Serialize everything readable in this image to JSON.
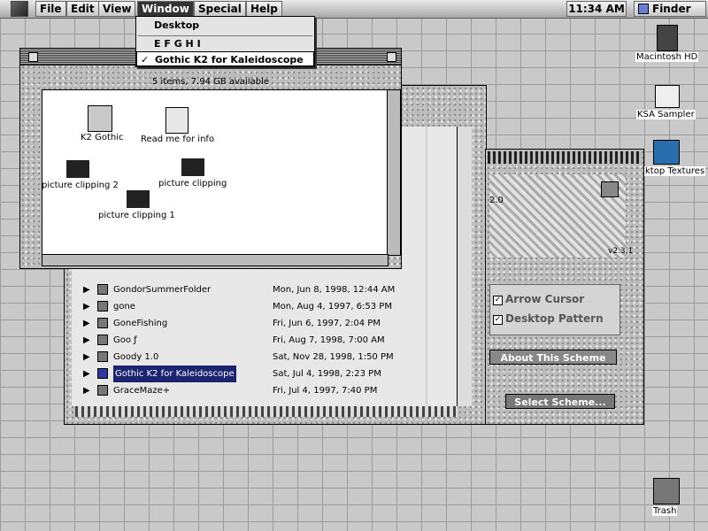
{
  "menubar": {
    "items": [
      "File",
      "Edit",
      "View",
      "Window",
      "Special",
      "Help"
    ],
    "clock": "11:34 AM",
    "app": "Finder"
  },
  "window_menu": {
    "items": [
      "Desktop",
      "E F G H I",
      "Gothic K2 for Kaleidoscope"
    ],
    "checked_item": "Gothic K2 for Kaleidoscope",
    "check_mark": "✓"
  },
  "front_window": {
    "status": "5 items, 7.94 GB available",
    "icons": [
      "K2 Gothic",
      "Read me for info",
      "picture clipping 2",
      "picture clipping",
      "picture clipping 1"
    ]
  },
  "list_window": {
    "rows": [
      {
        "name": "GondorSummerFolder",
        "date": "Mon, Jun 8, 1998, 12:44 AM",
        "selected": false
      },
      {
        "name": "gone",
        "date": "Mon, Aug 4, 1997, 6:53 PM",
        "selected": false
      },
      {
        "name": "GoneFishing",
        "date": "Fri, Jun 6, 1997, 2:04 PM",
        "selected": false
      },
      {
        "name": "Goo ƒ",
        "date": "Fri, Aug 7, 1998, 7:00 AM",
        "selected": false
      },
      {
        "name": "Goody 1.0",
        "date": "Sat, Nov 28, 1998, 1:50 PM",
        "selected": false
      },
      {
        "name": "Gothic K2 for Kaleidoscope",
        "date": "Sat, Jul 4, 1998, 2:23 PM",
        "selected": true
      },
      {
        "name": "GraceMaze+",
        "date": "Fri, Jul 4, 1997, 7:40 PM",
        "selected": false
      }
    ],
    "triangle": "▶"
  },
  "scheme_panel": {
    "version_left": "2.0",
    "version_right": "v2.3.1",
    "arrow_cursor": "Arrow Cursor",
    "desktop_pattern": "Desktop Pattern",
    "about_button": "About This Scheme",
    "select_button": "Select Scheme..."
  },
  "desktop_icons": [
    "Macintosh HD",
    "KSA Sampler",
    "ktop Textures",
    "Trash"
  ],
  "colors": {
    "selection": "#1c2470",
    "menu_highlight": "#333333"
  }
}
